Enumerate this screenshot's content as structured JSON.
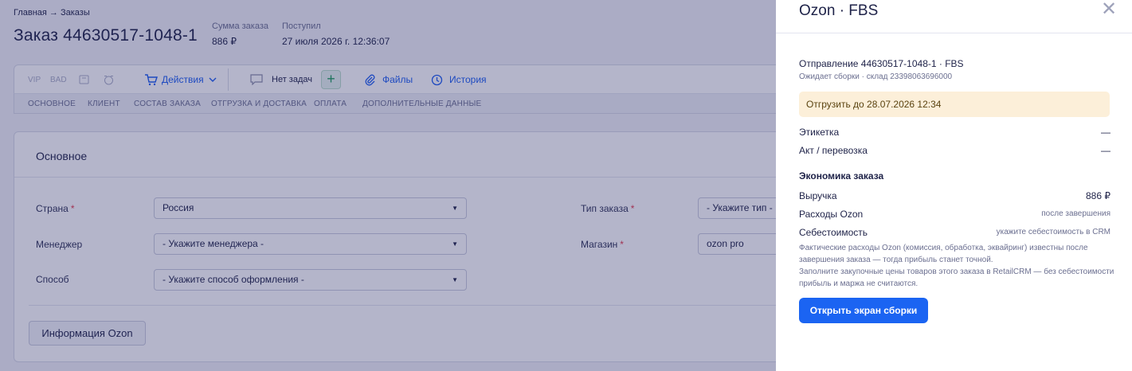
{
  "breadcrumb": "Главная → Заказы",
  "order": {
    "title": "Заказ 44630517-1048-1",
    "sum_label": "Сумма заказа",
    "sum_value": "886 ₽",
    "received_label": "Поступил",
    "received_value": "27 июля 2026 г. 12:36:07"
  },
  "toolbar": {
    "vip": "VIP",
    "bad": "BAD",
    "actions": "Действия",
    "no_tasks": "Нет задач",
    "add": "+",
    "files": "Файлы",
    "history": "История"
  },
  "tabs": [
    "ОСНОВНОЕ",
    "КЛИЕНТ",
    "СОСТАВ ЗАКАЗА",
    "ОТГРУЗКА И ДОСТАВКА",
    "ОПЛАТА",
    "ДОПОЛНИТЕЛЬНЫЕ ДАННЫЕ"
  ],
  "main": {
    "title": "Основное",
    "country_label": "Страна",
    "country_value": "Россия",
    "manager_label": "Менеджер",
    "manager_value": "- Укажите менеджера -",
    "method_label": "Способ",
    "method_value": "- Укажите способ оформления -",
    "order_type_label": "Тип заказа",
    "order_type_value": "- Укажите тип -",
    "shop_label": "Магазин",
    "shop_value": "ozon pro",
    "ozon_button": "Информация Ozon",
    "required_mark": "*"
  },
  "drawer": {
    "title": "Ozon · FBS",
    "close": "✕",
    "shipment_title": "Отправление 44630517-1048-1 · FBS",
    "shipment_sub": "Ожидает сборки · склад 23398063696000",
    "deadline": "Отгрузить до 28.07.2026 12:34",
    "label_label": "Этикетка",
    "label_value": "—",
    "act_label": "Акт / перевозка",
    "act_value": "—",
    "economics_title": "Экономика заказа",
    "revenue_label": "Выручка",
    "revenue_value": "886 ₽",
    "costs_label": "Расходы Ozon",
    "costs_value": "после завершения",
    "cogs_label": "Себестоимость",
    "cogs_value": "укажите себестоимость в CRM",
    "note1": "Фактические расходы Ozon (комиссия, обработка, эквайринг) известны после завершения заказа — тогда прибыль станет точной.",
    "note2": "Заполните закупочные цены товаров этого заказа в RetailCRM — без себестоимости прибыль и маржа не считаются.",
    "open_button": "Открыть экран сборки"
  }
}
